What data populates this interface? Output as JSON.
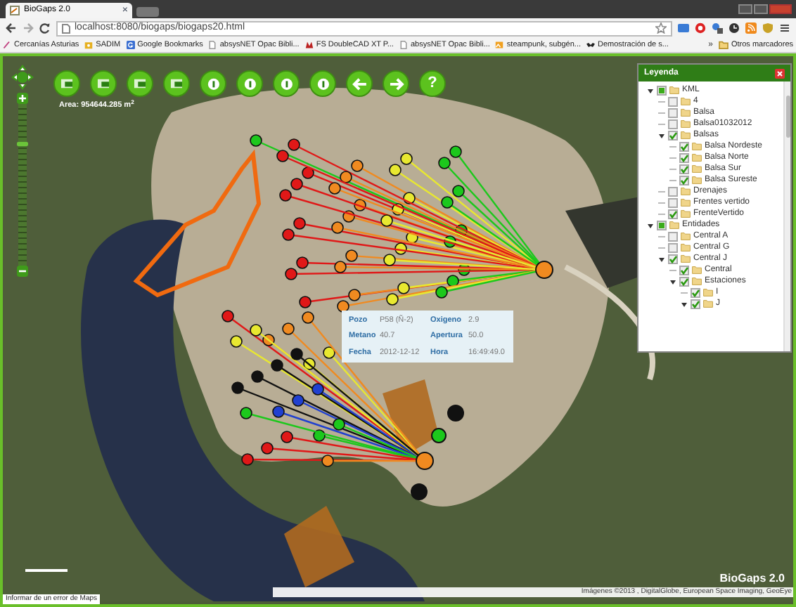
{
  "browser": {
    "tab_title": "BioGaps 2.0",
    "tab_close": "×",
    "url": "localhost:8080/biogaps/biogaps20.html",
    "bookmarks": [
      {
        "label": "Cercanías Asturias"
      },
      {
        "label": "SADIM"
      },
      {
        "label": "Google Bookmarks"
      },
      {
        "label": "absysNET Opac Bibli..."
      },
      {
        "label": "FS DoubleCAD XT P..."
      },
      {
        "label": "absysNET Opac Bibli..."
      },
      {
        "label": "steampunk, subgén..."
      },
      {
        "label": "Demostración de s..."
      }
    ],
    "more": "»",
    "other_bookmarks": "Otros marcadores"
  },
  "map": {
    "area": "Area: 954644.285 m$^{2}$",
    "toolbar": [
      {
        "kind": "tool"
      },
      {
        "kind": "tool"
      },
      {
        "kind": "tool"
      },
      {
        "kind": "tool"
      },
      {
        "kind": "info"
      },
      {
        "kind": "info"
      },
      {
        "kind": "info"
      },
      {
        "kind": "info"
      },
      {
        "kind": "left"
      },
      {
        "kind": "right"
      },
      {
        "kind": "help",
        "label": "?"
      }
    ],
    "zoom_slider": {
      "level": 0.76
    },
    "popup": {
      "rows": [
        [
          "Pozo",
          "P58 (Ñ-2)",
          "Oxigeno",
          "2.9"
        ],
        [
          "Metano",
          "40.7",
          "Apertura",
          "50.0"
        ],
        [
          "Fecha",
          "2012-12-12",
          "Hora",
          "16:49:49.0"
        ]
      ]
    },
    "brand": "BioGaps 2.0",
    "attribution": "Imágenes ©2013 , DigitalGlobe, European Space Imaging, GeoEye",
    "report_link": "Informar de un error de Maps"
  },
  "legend": {
    "title": "Leyenda",
    "tree": [
      {
        "label": "KML",
        "checked": false,
        "partial": true,
        "expanded": true,
        "children": [
          {
            "label": "4",
            "checked": false
          },
          {
            "label": "Balsa",
            "checked": false
          },
          {
            "label": "Balsa01032012",
            "checked": false
          },
          {
            "label": "Balsas",
            "checked": true,
            "expanded": true,
            "children": [
              {
                "label": "Balsa Nordeste",
                "checked": true
              },
              {
                "label": "Balsa Norte",
                "checked": true
              },
              {
                "label": "Balsa Sur",
                "checked": true
              },
              {
                "label": "Balsa Sureste",
                "checked": true
              }
            ]
          },
          {
            "label": "Drenajes",
            "checked": false
          },
          {
            "label": "Frentes vertido",
            "checked": false
          },
          {
            "label": "FrenteVertido",
            "checked": true
          }
        ]
      },
      {
        "label": "Entidades",
        "checked": false,
        "partial": true,
        "expanded": true,
        "children": [
          {
            "label": "Central A",
            "checked": false
          },
          {
            "label": "Central G",
            "checked": false
          },
          {
            "label": "Central J",
            "checked": true,
            "expanded": true,
            "children": [
              {
                "label": "Central",
                "checked": true
              },
              {
                "label": "Estaciones",
                "checked": true,
                "expanded": true,
                "children": [
                  {
                    "label": "I",
                    "checked": true
                  },
                  {
                    "label": "J",
                    "checked": true,
                    "expanded": true
                  }
                ]
              }
            ]
          }
        ]
      }
    ]
  }
}
